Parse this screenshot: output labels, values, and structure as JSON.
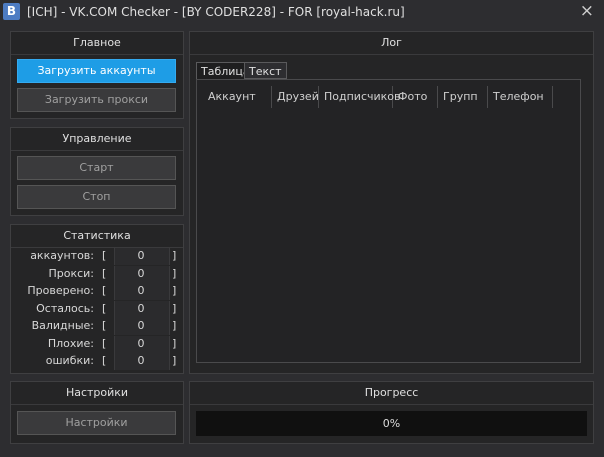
{
  "window": {
    "icon_letter": "B",
    "title": "[ICH] - VK.COM Checker - [BY CODER228] - FOR [royal-hack.ru]",
    "close": "×"
  },
  "main": {
    "header": "Главное",
    "load_accounts": "Загрузить аккаунты",
    "load_proxies": "Загрузить прокси"
  },
  "control": {
    "header": "Управление",
    "start": "Старт",
    "stop": "Стоп"
  },
  "stats": {
    "header": "Статистика",
    "rows": [
      {
        "label": "аккаунтов:",
        "lb": "[",
        "value": "0",
        "rb": "]"
      },
      {
        "label": "Прокси:",
        "lb": "[",
        "value": "0",
        "rb": "]"
      },
      {
        "label": "Проверено:",
        "lb": "[",
        "value": "0",
        "rb": "]"
      },
      {
        "label": "Осталось:",
        "lb": "[",
        "value": "0",
        "rb": "]"
      },
      {
        "label": "Валидные:",
        "lb": "[",
        "value": "0",
        "rb": "]"
      },
      {
        "label": "Плохие:",
        "lb": "[",
        "value": "0",
        "rb": "]"
      },
      {
        "label": "ошибки:",
        "lb": "[",
        "value": "0",
        "rb": "]"
      }
    ]
  },
  "log": {
    "header": "Лог",
    "tabs": [
      "Таблица",
      "Текст"
    ],
    "columns": [
      "Аккаунт",
      "Друзей",
      "Подписчиков",
      "Фото",
      "Групп",
      "Телефон"
    ]
  },
  "settings": {
    "header": "Настройки",
    "button": "Настройки"
  },
  "progress": {
    "header": "Прогресс",
    "value_text": "0%"
  }
}
